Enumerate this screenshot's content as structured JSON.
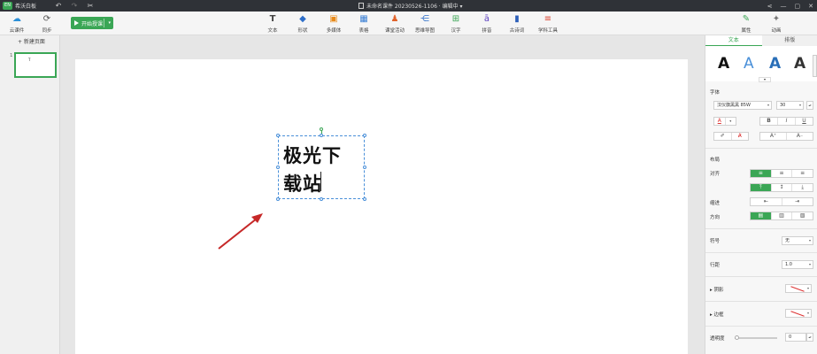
{
  "titlebar": {
    "app_name": "希沃白板",
    "doc_title": "未命名课件 20230526-1106 · 编辑中 ▾"
  },
  "toolbar": {
    "cloud_label": "云课件",
    "sync_label": "同步",
    "start_label": "开始授课",
    "tools": [
      {
        "label": "文本",
        "icon": "text-icon"
      },
      {
        "label": "形状",
        "icon": "shape-icon"
      },
      {
        "label": "多媒体",
        "icon": "media-icon"
      },
      {
        "label": "表格",
        "icon": "table-icon"
      },
      {
        "label": "课堂活动",
        "icon": "activity-icon"
      },
      {
        "label": "思维导图",
        "icon": "mindmap-icon"
      },
      {
        "label": "汉字",
        "icon": "hanzi-icon"
      },
      {
        "label": "拼音",
        "icon": "pinyin-icon"
      },
      {
        "label": "古诗词",
        "icon": "poem-icon"
      },
      {
        "label": "学科工具",
        "icon": "subject-tools-icon"
      }
    ],
    "attr_label": "属性",
    "anim_label": "动画"
  },
  "leftpanel": {
    "new_page_label": "+ 新建页面",
    "slide_number": "1",
    "thumb_text": "T"
  },
  "canvas": {
    "text_line1": "极光下",
    "text_line2": "载站"
  },
  "rightpanel": {
    "tab_text": "文本",
    "tab_layout": "排版",
    "style_glyph": "A",
    "font_section": "字体",
    "font_name": "汉仪旗黑黑 85W",
    "font_size": "30",
    "bold": "B",
    "italic": "I",
    "underline": "U",
    "text_color_glyph": "A",
    "grow_font": "A⁺",
    "shrink_font": "A₋",
    "layout_section": "布局",
    "align_label": "对齐",
    "indent_label": "缩进",
    "direction_label": "方向",
    "symbol_label": "符号",
    "symbol_value": "无",
    "line_height_label": "行距",
    "line_height_value": "1.0",
    "shadow_label": "阴影",
    "border_label": "边框",
    "opacity_label": "透明度",
    "opacity_value": "0"
  },
  "colors": {
    "accent": "#3aa655",
    "selection": "#4a90d9",
    "annotation_arrow": "#c62828"
  }
}
